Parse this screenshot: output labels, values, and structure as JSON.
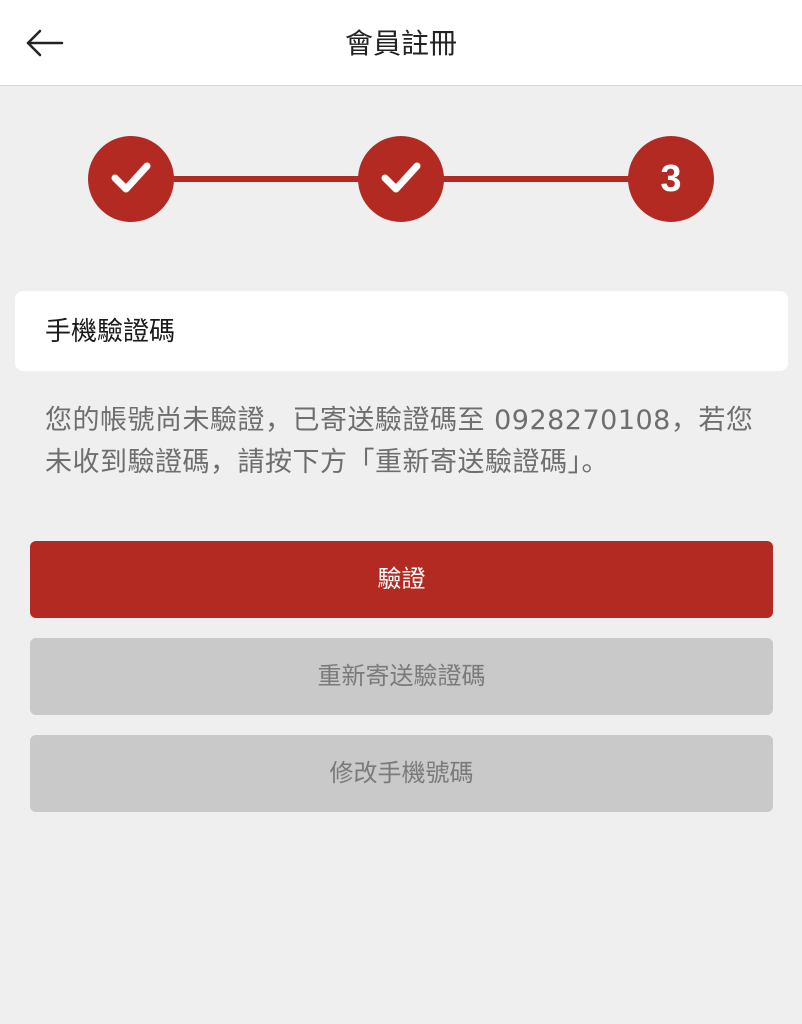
{
  "header": {
    "title": "會員註冊",
    "back_icon": "arrow-left-icon"
  },
  "stepper": {
    "steps": [
      {
        "state": "completed",
        "icon": "check-icon"
      },
      {
        "state": "completed",
        "icon": "check-icon"
      },
      {
        "state": "current",
        "label": "3"
      }
    ],
    "accent_color": "#b22a22"
  },
  "verification": {
    "field_label": "手機驗證碼",
    "message": "您的帳號尚未驗證，已寄送驗證碼至 0928270108，若您未收到驗證碼，請按下方「重新寄送驗證碼」。"
  },
  "buttons": {
    "verify_label": "驗證",
    "resend_label": "重新寄送驗證碼",
    "change_phone_label": "修改手機號碼"
  }
}
